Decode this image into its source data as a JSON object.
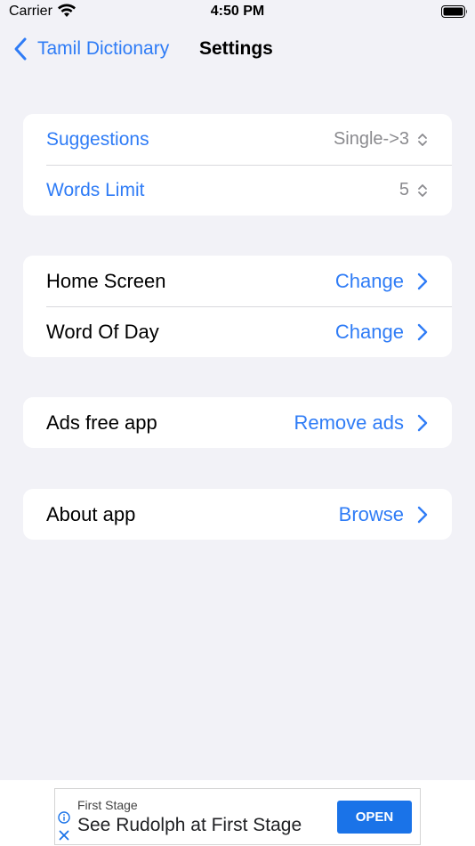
{
  "status_bar": {
    "carrier": "Carrier",
    "time": "4:50 PM",
    "icons": [
      "wifi-icon",
      "battery-icon"
    ]
  },
  "nav": {
    "back_label": "Tamil Dictionary",
    "title": "Settings"
  },
  "groups": [
    {
      "rows": [
        {
          "label": "Suggestions",
          "value": "Single->3",
          "control": "popup-updown-icon"
        },
        {
          "label": "Words Limit",
          "value": "5",
          "control": "popup-updown-icon"
        }
      ]
    },
    {
      "rows": [
        {
          "label": "Home Screen",
          "value": "Change",
          "control": "chevron-right-icon"
        },
        {
          "label": "Word Of Day",
          "value": "Change",
          "control": "chevron-right-icon"
        }
      ]
    },
    {
      "rows": [
        {
          "label": "Ads free app",
          "value": "Remove ads",
          "control": "chevron-right-icon"
        }
      ]
    },
    {
      "rows": [
        {
          "label": "About app",
          "value": "Browse",
          "control": "chevron-right-icon"
        }
      ]
    }
  ],
  "ad": {
    "sponsor": "First Stage",
    "headline": "See Rudolph at First Stage",
    "button": "OPEN"
  },
  "colors": {
    "accent": "#2f7cf6",
    "background": "#f2f2f7",
    "secondary_text": "#8a8a8e",
    "ad_button": "#1a73e8"
  }
}
